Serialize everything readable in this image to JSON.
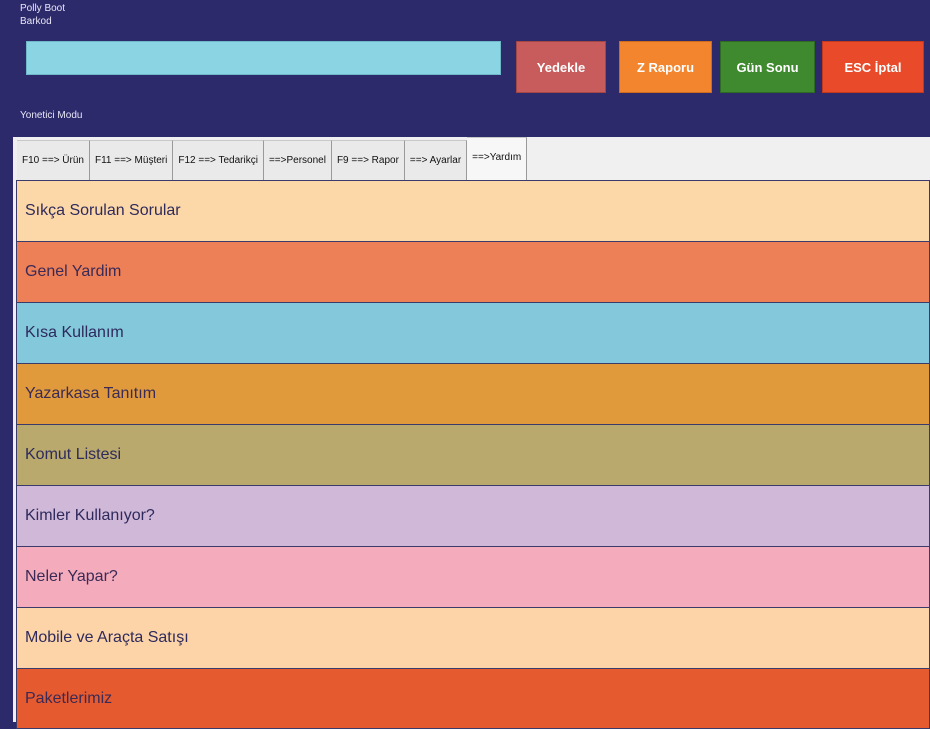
{
  "header": {
    "app_title": "Polly Boot",
    "barkod_label": "Barkod",
    "barcode_value": "",
    "mode_label": "Yonetici Modu"
  },
  "actions": [
    {
      "label": "Yedekle",
      "color": "#c85b5b"
    },
    {
      "label": "Z Raporu",
      "color": "#f2852e"
    },
    {
      "label": "Gün Sonu",
      "color": "#3f8a2f"
    },
    {
      "label": "ESC İptal",
      "color": "#e84a2a"
    }
  ],
  "tabs": [
    {
      "label": "F10 ==> Ürün"
    },
    {
      "label": "F11 ==> Müşteri"
    },
    {
      "label": "F12 ==> Tedarikçi"
    },
    {
      "label": "==>Personel"
    },
    {
      "label": "F9 ==> Rapor"
    },
    {
      "label": "==> Ayarlar"
    },
    {
      "label": "==>Yardım",
      "active": true
    }
  ],
  "help_items": [
    {
      "label": "Sıkça Sorulan Sorular",
      "bg": "#fcd8a8",
      "fg": "#2e2a5c"
    },
    {
      "label": "Genel Yardim",
      "bg": "#ee8058",
      "fg": "#3a2a55"
    },
    {
      "label": "Kısa Kullanım",
      "bg": "#84c8dc",
      "fg": "#2e2a5c"
    },
    {
      "label": "Yazarkasa Tanıtım",
      "bg": "#e09a3c",
      "fg": "#3a2a55"
    },
    {
      "label": "Komut Listesi",
      "bg": "#b9a96c",
      "fg": "#2e2a5c"
    },
    {
      "label": "Kimler Kullanıyor?",
      "bg": "#d0b8d8",
      "fg": "#2e2a5c"
    },
    {
      "label": "Neler Yapar?",
      "bg": "#f4acbc",
      "fg": "#3a2a55"
    },
    {
      "label": "Mobile ve Araçta Satışı",
      "bg": "#fcd4a8",
      "fg": "#2e2a5c"
    },
    {
      "label": "Paketlerimiz",
      "bg": "#e65a30",
      "fg": "#3a2a55"
    }
  ]
}
